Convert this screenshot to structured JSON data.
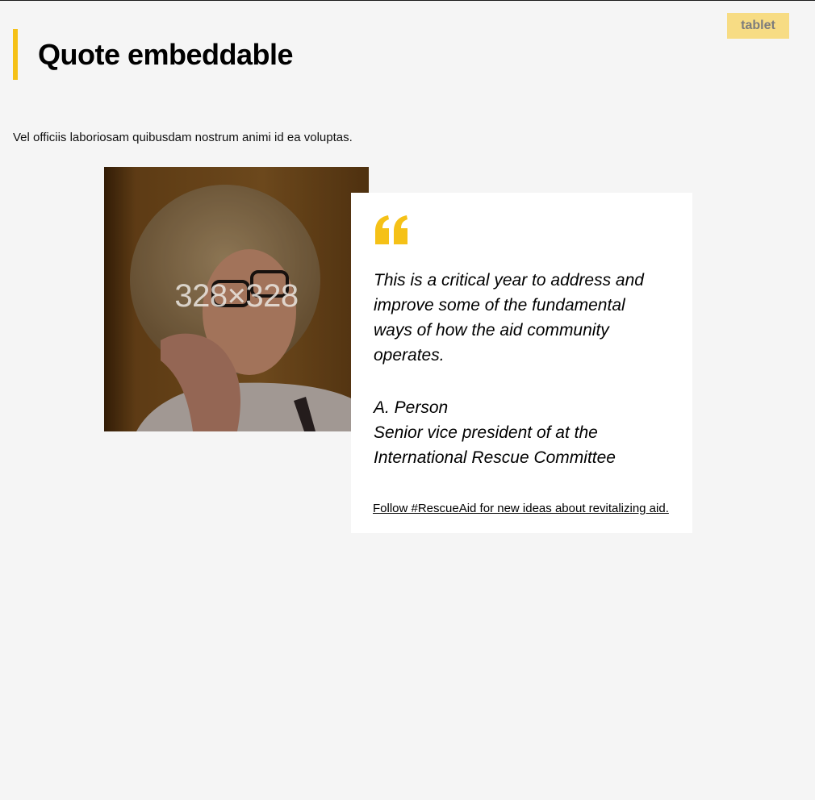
{
  "viewport_badge": "tablet",
  "page_title": "Quote embeddable",
  "intro_text": "Vel officiis laboriosam quibusdam nostrum animi id ea voluptas.",
  "image": {
    "placeholder_label": "328×328"
  },
  "quote": {
    "text": "This is a critical year to address and improve some of the fundamental ways of how the aid community operates.",
    "author_name": "A. Person",
    "author_title_line1": "Senior vice president of at the",
    "author_title_line2": "International Rescue Committee",
    "link_text": "Follow #RescueAid for new ideas about revitalizing aid."
  },
  "colors": {
    "accent": "#f5c117",
    "badge_bg": "#f7dc84",
    "page_bg": "#f5f5f5",
    "card_bg": "#ffffff"
  },
  "icons": {
    "quote_mark": "open-quote-icon"
  }
}
